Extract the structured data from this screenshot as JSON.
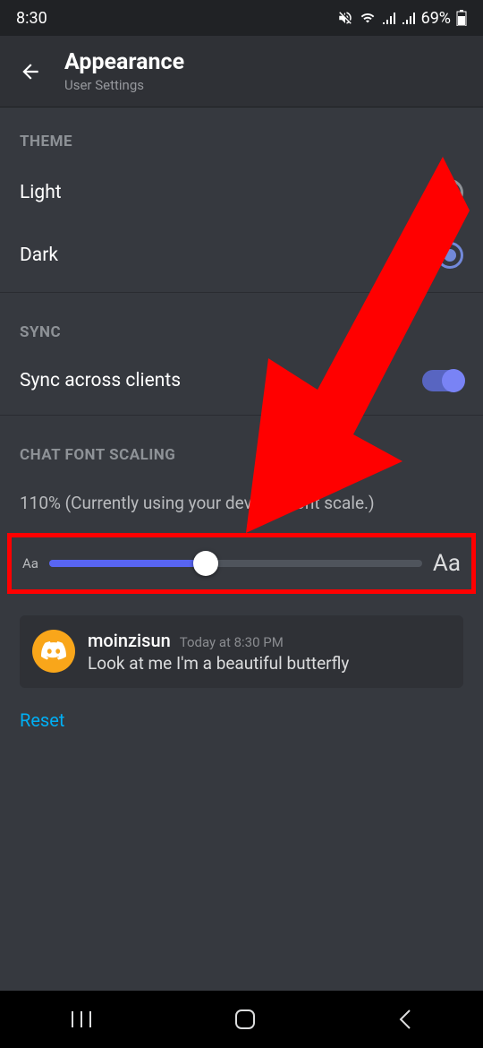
{
  "statusbar": {
    "time": "8:30",
    "battery": "69%"
  },
  "header": {
    "title": "Appearance",
    "subtitle": "User Settings"
  },
  "theme": {
    "header": "THEME",
    "options": [
      {
        "label": "Light",
        "selected": false
      },
      {
        "label": "Dark",
        "selected": true
      }
    ]
  },
  "sync": {
    "header": "SYNC",
    "label": "Sync across clients",
    "enabled": true
  },
  "font_scaling": {
    "header": "CHAT FONT SCALING",
    "status": "110% (Currently using your device's font scale.)",
    "small_marker": "Aa",
    "large_marker": "Aa"
  },
  "preview": {
    "username": "moinzisun",
    "timestamp": "Today at 8:30 PM",
    "message": "Look at me I'm a beautiful butterfly"
  },
  "reset_label": "Reset"
}
